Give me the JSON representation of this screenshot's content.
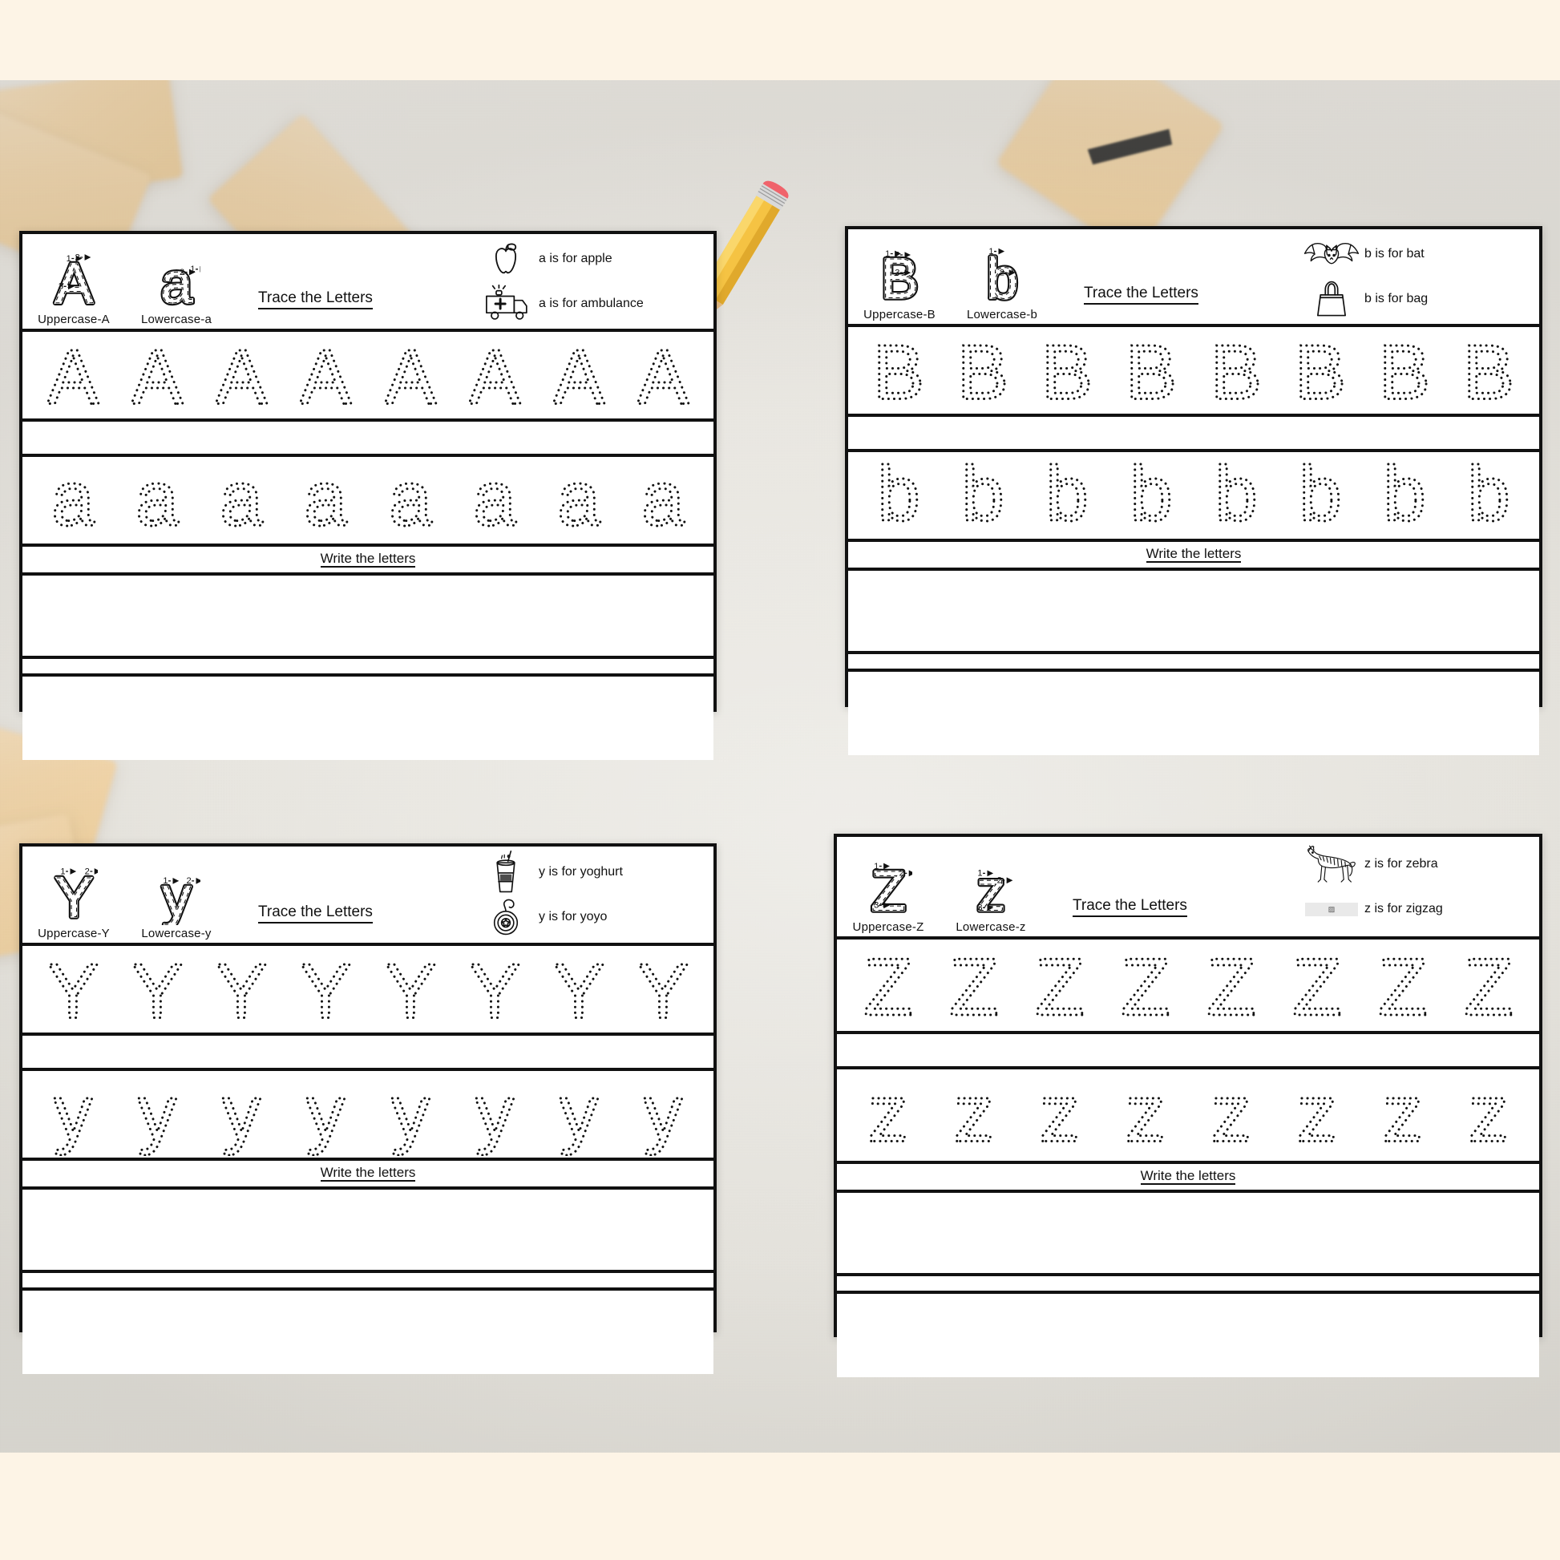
{
  "page": {
    "background_color": "#FDF4E6",
    "desk_color": "#ECEAE4",
    "tile_color": "#F8D9A8",
    "ink_color": "#111111",
    "paper_color": "#FFFFFF"
  },
  "common": {
    "trace_title": "Trace the Letters",
    "write_title": "Write the letters ",
    "uppercase_prefix": "Uppercase-",
    "lowercase_prefix": "Lowercase-",
    "trace_count": 8,
    "broken_image_glyph": "▨"
  },
  "worksheets": [
    {
      "id": "worksheet-a",
      "letter_upper": "A",
      "letter_lower": "a",
      "uppercase_label": "Uppercase-A",
      "lowercase_label": "Lowercase-a",
      "trace_title": "Trace the Letters",
      "write_title": "Write the letters ",
      "words": [
        {
          "icon": "apple-icon",
          "text": "a is for apple",
          "broken": false
        },
        {
          "icon": "ambulance-icon",
          "text": "a is for ambulance",
          "broken": false
        }
      ],
      "stroke_numbers_upper": [
        "1",
        "2",
        "3"
      ],
      "stroke_numbers_lower": [
        "1",
        "2"
      ]
    },
    {
      "id": "worksheet-b",
      "letter_upper": "B",
      "letter_lower": "b",
      "uppercase_label": "Uppercase-B",
      "lowercase_label": "Lowercase-b",
      "trace_title": "Trace the Letters",
      "write_title": "Write the letters ",
      "words": [
        {
          "icon": "bat-icon",
          "text": "b is for bat",
          "broken": false
        },
        {
          "icon": "bag-icon",
          "text": "b is for bag",
          "broken": false
        }
      ],
      "stroke_numbers_upper": [
        "1",
        "2",
        "3"
      ],
      "stroke_numbers_lower": [
        "1",
        "2"
      ]
    },
    {
      "id": "worksheet-y",
      "letter_upper": "Y",
      "letter_lower": "y",
      "uppercase_label": "Uppercase-Y",
      "lowercase_label": "Lowercase-y",
      "trace_title": "Trace the Letters",
      "write_title": "Write the letters ",
      "words": [
        {
          "icon": "yoghurt-cup-icon",
          "text": "y is for yoghurt",
          "broken": false
        },
        {
          "icon": "yoyo-icon",
          "text": "y is for yoyo",
          "broken": false
        }
      ],
      "stroke_numbers_upper": [
        "1",
        "2"
      ],
      "stroke_numbers_lower": [
        "1",
        "2"
      ]
    },
    {
      "id": "worksheet-z",
      "letter_upper": "Z",
      "letter_lower": "z",
      "uppercase_label": "Uppercase-Z",
      "lowercase_label": "Lowercase-z",
      "trace_title": "Trace the Letters",
      "write_title": "Write the letters ",
      "words": [
        {
          "icon": "zebra-icon",
          "text": "z is for zebra",
          "broken": false
        },
        {
          "icon": "broken-image-icon",
          "text": "z is for zigzag",
          "broken": true
        }
      ],
      "stroke_numbers_upper": [
        "1",
        "2",
        "3"
      ],
      "stroke_numbers_lower": [
        "1",
        "2",
        "3"
      ]
    }
  ]
}
